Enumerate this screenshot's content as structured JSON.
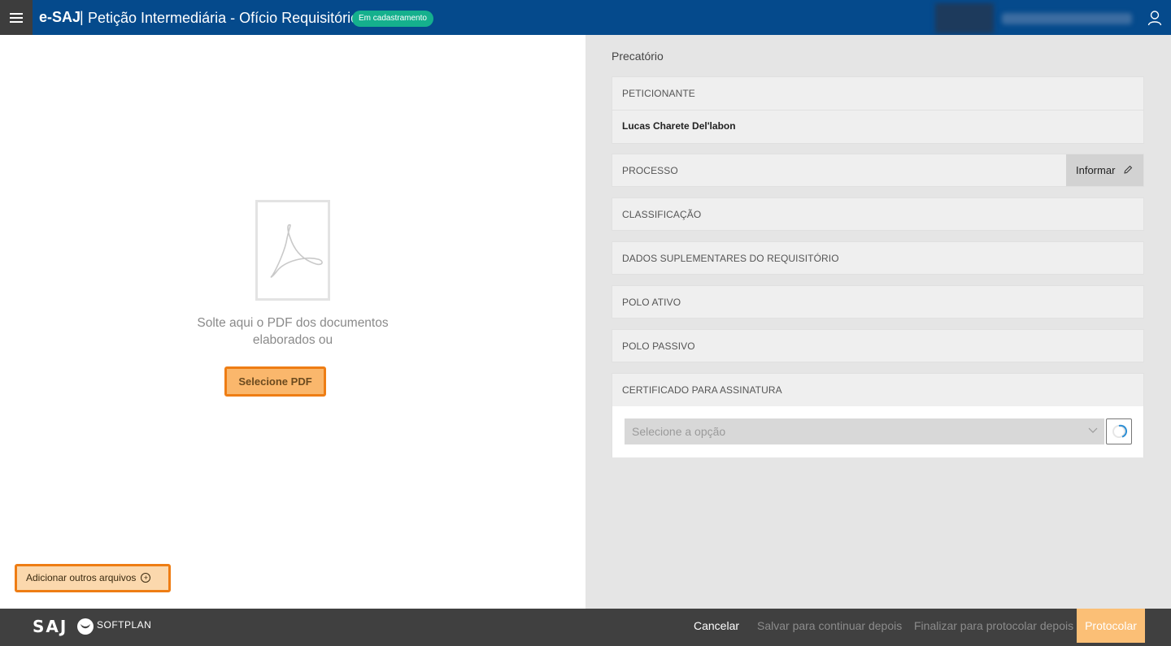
{
  "header": {
    "brand": "e-SAJ",
    "separator": "|",
    "title": "Petição Intermediária - Ofício Requisitório",
    "status_badge": "Em cadastramento",
    "colors": {
      "bar": "#054a8c",
      "badge": "#15b08d"
    },
    "icons": [
      "menu-icon",
      "user-icon"
    ]
  },
  "upload": {
    "drop_text": "Solte aqui o PDF dos documentos elaborados ou",
    "select_button": "Selecione PDF",
    "add_files_button": "Adicionar outros arquivos",
    "icons": [
      "pdf-icon",
      "plus-circle-icon"
    ]
  },
  "form": {
    "section_title": "Precatório",
    "peticionante": {
      "label": "PETICIONANTE",
      "value": "Lucas Charete Del'labon"
    },
    "processo": {
      "label": "PROCESSO",
      "action": "Informar"
    },
    "classificacao": {
      "label": "CLASSIFICAÇÃO"
    },
    "dados_suplementares": {
      "label": "DADOS SUPLEMENTARES DO REQUISITÓRIO"
    },
    "polo_ativo": {
      "label": "POLO ATIVO"
    },
    "polo_passivo": {
      "label": "POLO PASSIVO"
    },
    "certificado": {
      "label": "CERTIFICADO PARA ASSINATURA",
      "placeholder": "Selecione a opção"
    }
  },
  "footer": {
    "logo_text": "SAJ",
    "company": "SOFTPLAN",
    "buttons": {
      "cancel": "Cancelar",
      "save": "Salvar para continuar depois",
      "finish": "Finalizar para protocolar depois",
      "submit": "Protocolar"
    },
    "colors": {
      "submit": "#fbbf76",
      "highlight_border": "#ee7d14"
    }
  }
}
